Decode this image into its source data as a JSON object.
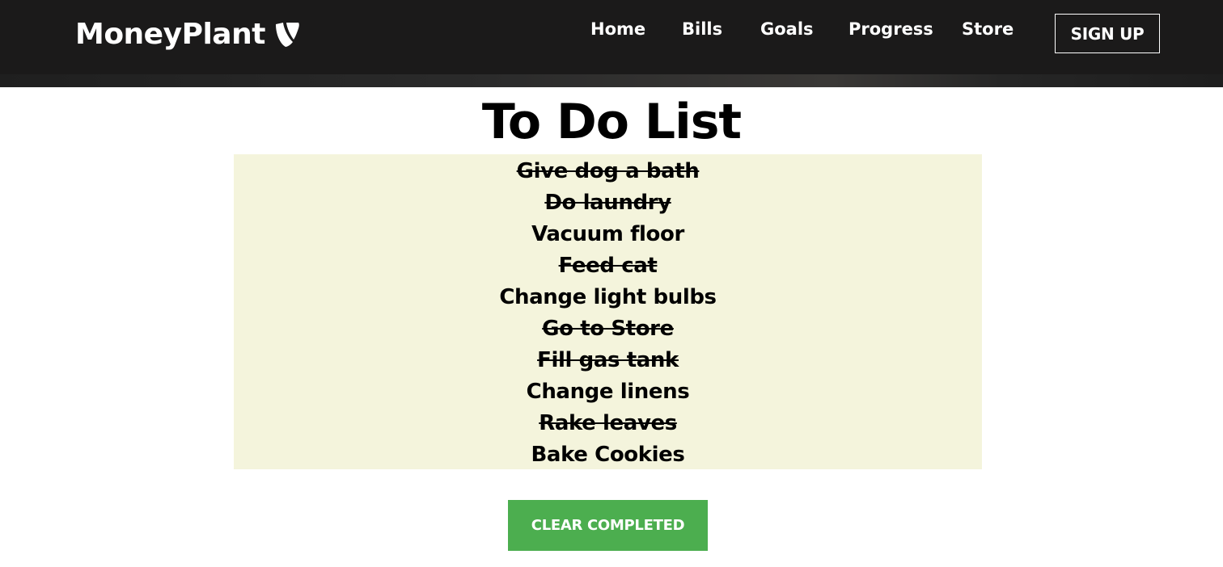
{
  "brand": {
    "name": "MoneyPlant",
    "logo_icon": "typo3-shield-icon"
  },
  "nav": {
    "items": [
      {
        "label": "Home"
      },
      {
        "label": "Bills"
      },
      {
        "label": "Goals"
      },
      {
        "label": "Progress"
      },
      {
        "label": "Store"
      }
    ],
    "signup_label": "SIGN UP"
  },
  "main": {
    "title": "To Do List",
    "todos": [
      {
        "text": "Give dog a bath",
        "completed": true
      },
      {
        "text": "Do laundry",
        "completed": true
      },
      {
        "text": "Vacuum floor",
        "completed": false
      },
      {
        "text": "Feed cat",
        "completed": true
      },
      {
        "text": "Change light bulbs",
        "completed": false
      },
      {
        "text": "Go to Store",
        "completed": true
      },
      {
        "text": "Fill gas tank",
        "completed": true
      },
      {
        "text": "Change linens",
        "completed": false
      },
      {
        "text": "Rake leaves",
        "completed": true
      },
      {
        "text": "Bake Cookies",
        "completed": false
      }
    ],
    "clear_button_label": "CLEAR COMPLETED"
  },
  "colors": {
    "navbar_bg": "#1b1a1a",
    "list_bg": "#f4f4dc",
    "clear_button_bg": "#4cae4f"
  }
}
